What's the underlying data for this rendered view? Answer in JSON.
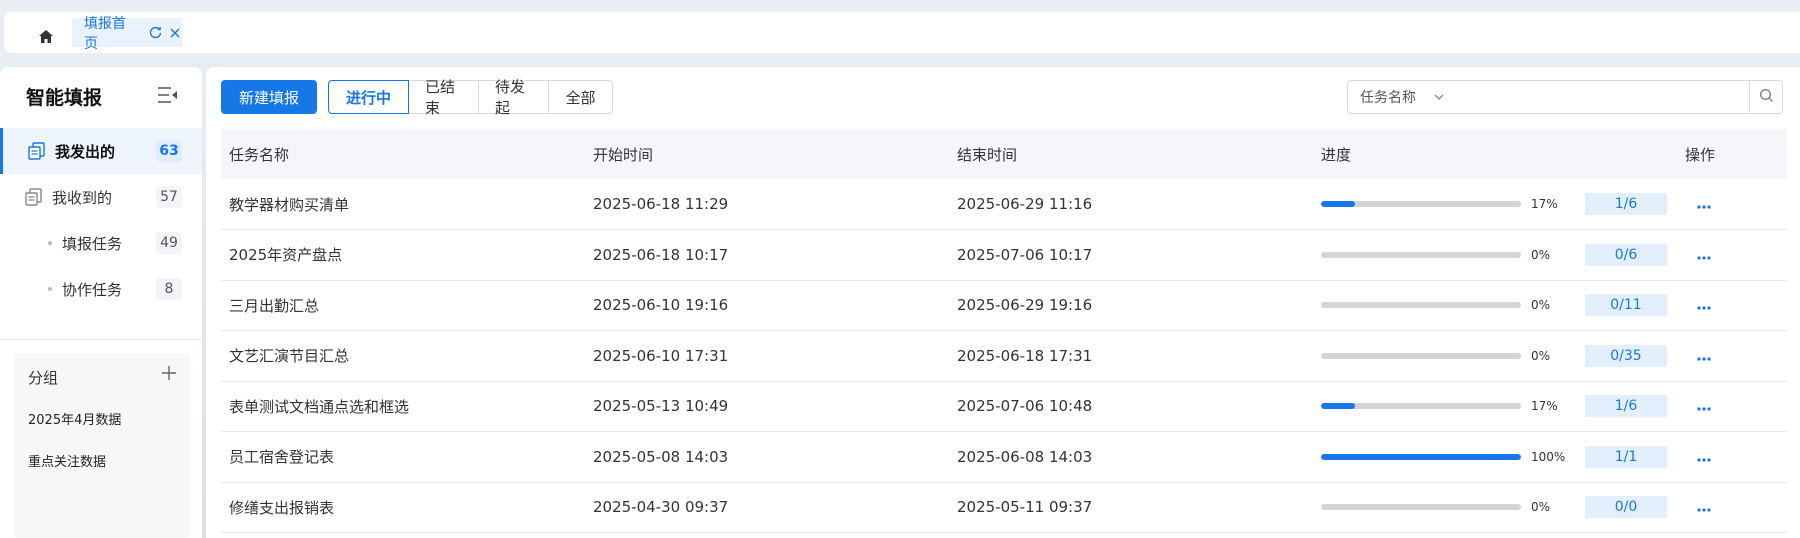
{
  "tabs": {
    "active_label": "填报首页"
  },
  "sidebar": {
    "title": "智能填报",
    "items": [
      {
        "label": "我发出的",
        "count": "63"
      },
      {
        "label": "我收到的",
        "count": "57"
      },
      {
        "label": "填报任务",
        "count": "49"
      },
      {
        "label": "协作任务",
        "count": "8"
      }
    ],
    "group": {
      "title": "分组",
      "items": [
        "2025年4月数据",
        "重点关注数据"
      ]
    }
  },
  "toolbar": {
    "new_label": "新建填报",
    "filters": [
      "进行中",
      "已结束",
      "待发起",
      "全部"
    ],
    "search_field": "任务名称",
    "search_placeholder": ""
  },
  "table": {
    "headers": [
      "任务名称",
      "开始时间",
      "结束时间",
      "进度",
      "操作"
    ],
    "rows": [
      {
        "name": "教学器材购买清单",
        "start": "2025-06-18 11:29",
        "end": "2025-06-29 11:16",
        "progress": 17,
        "pct": "17%",
        "ratio": "1/6"
      },
      {
        "name": "2025年资产盘点",
        "start": "2025-06-18 10:17",
        "end": "2025-07-06 10:17",
        "progress": 0,
        "pct": "0%",
        "ratio": "0/6"
      },
      {
        "name": "三月出勤汇总",
        "start": "2025-06-10 19:16",
        "end": "2025-06-29 19:16",
        "progress": 0,
        "pct": "0%",
        "ratio": "0/11"
      },
      {
        "name": "文艺汇演节目汇总",
        "start": "2025-06-10 17:31",
        "end": "2025-06-18 17:31",
        "progress": 0,
        "pct": "0%",
        "ratio": "0/35"
      },
      {
        "name": "表单测试文档通点选和框选",
        "start": "2025-05-13 10:49",
        "end": "2025-07-06 10:48",
        "progress": 17,
        "pct": "17%",
        "ratio": "1/6"
      },
      {
        "name": "员工宿舍登记表",
        "start": "2025-05-08 14:03",
        "end": "2025-06-08 14:03",
        "progress": 100,
        "pct": "100%",
        "ratio": "1/1"
      },
      {
        "name": "修缮支出报销表",
        "start": "2025-04-30 09:37",
        "end": "2025-05-11 09:37",
        "progress": 0,
        "pct": "0%",
        "ratio": "0/0"
      }
    ]
  },
  "colors": {
    "accent": "#1677e6"
  }
}
